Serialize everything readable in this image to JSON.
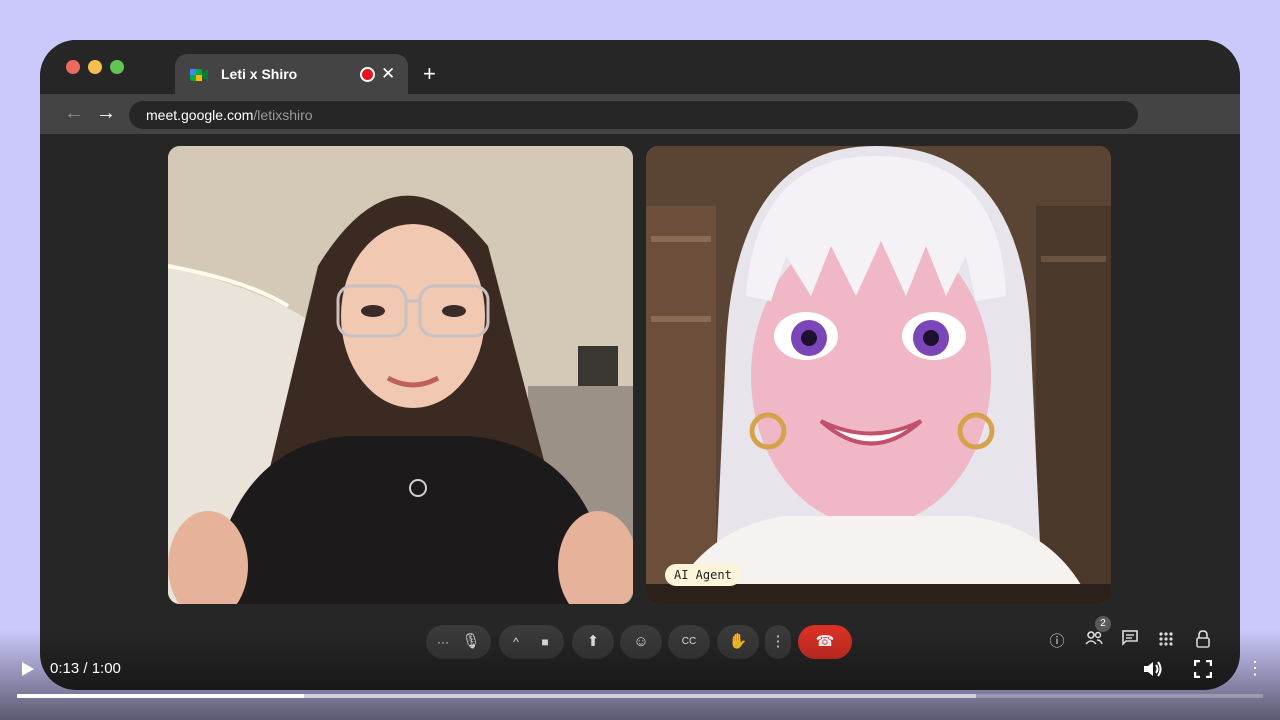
{
  "browser": {
    "tab_title": "Leti x Shiro",
    "url_host": "meet.google.com",
    "url_path": "/letixshiro",
    "close_glyph": "✕",
    "new_tab_glyph": "+",
    "back_glyph": "←",
    "forward_glyph": "→",
    "icons": [
      "meet-logo-icon",
      "recording-dot-icon",
      "close-icon",
      "new-tab-icon",
      "back-arrow-icon",
      "forward-arrow-icon"
    ]
  },
  "participants": [
    {
      "name": "",
      "description_icon": "webcam-video-woman"
    },
    {
      "name": "AI Agent",
      "description_icon": "animated-avatar-video"
    }
  ],
  "meet_controls": {
    "more_glyph": "···",
    "mic_glyph": "🎙",
    "chevron_glyph": "^",
    "camera_glyph": "■",
    "share_glyph": "⬆",
    "emoji_glyph": "☺",
    "captions_glyph": "CC",
    "hand_glyph": "✋",
    "kebab_glyph": "⋮",
    "end_call_glyph": "☎",
    "participants_count": "2",
    "right_icons": [
      "info-icon",
      "people-icon",
      "chat-icon",
      "apps-icon",
      "host-controls-icon"
    ],
    "colors": {
      "end_call": "#d93025",
      "control_bg": "#3a3a3a"
    }
  },
  "player": {
    "time_display": "0:13 / 1:00",
    "progress_fraction": 0.23,
    "buffered_fraction": 0.77,
    "more_glyph": "⋮"
  },
  "colors": {
    "page_bg": "#cbc8fb",
    "window_bg": "#262626",
    "tab_bg": "#444444",
    "recording_red": "#e8131a"
  }
}
